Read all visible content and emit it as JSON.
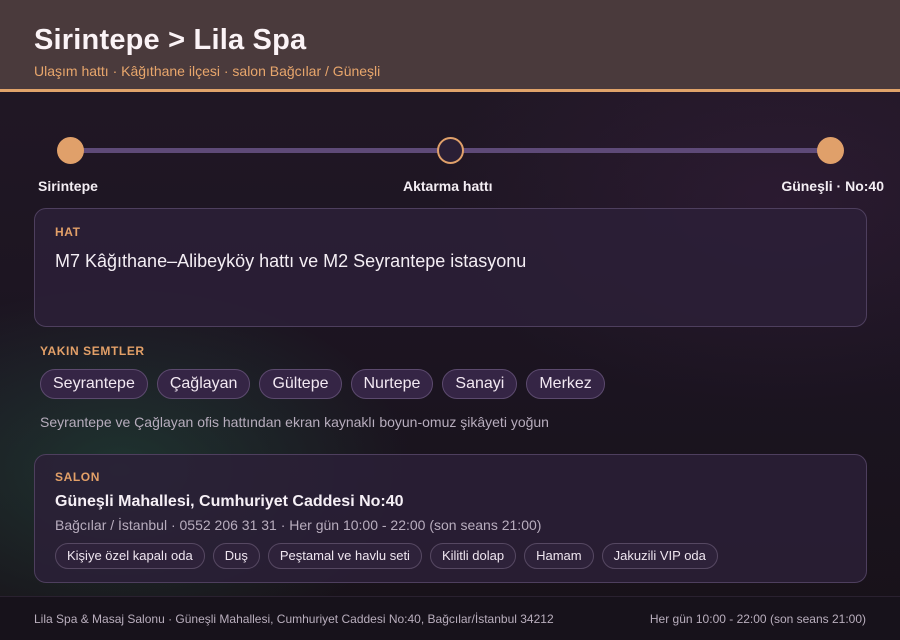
{
  "header": {
    "title": "Sirintepe > Lila Spa",
    "subtitle": "Ulaşım hattı · Kâğıthane ilçesi · salon Bağcılar / Güneşli"
  },
  "route": {
    "stops": [
      {
        "label": "Sirintepe"
      },
      {
        "label": "Aktarma hattı"
      },
      {
        "label": "Güneşli · No:40"
      }
    ]
  },
  "hat": {
    "label": "HAT",
    "text": "M7 Kâğıthane–Alibeyköy hattı ve M2 Seyrantepe istasyonu"
  },
  "nearby": {
    "label": "YAKIN SEMTLER",
    "items": [
      "Seyrantepe",
      "Çağlayan",
      "Gültepe",
      "Nurtepe",
      "Sanayi",
      "Merkez"
    ],
    "note": "Seyrantepe ve Çağlayan ofis hattından ekran kaynaklı boyun-omuz şikâyeti yoğun"
  },
  "salon": {
    "label": "SALON",
    "address": "Güneşli Mahallesi, Cumhuriyet Caddesi No:40",
    "meta": "Bağcılar / İstanbul · 0552 206 31 31 · Her gün 10:00 - 22:00 (son seans 21:00)",
    "features": [
      "Kişiye özel kapalı oda",
      "Duş",
      "Peştamal ve havlu seti",
      "Kilitli dolap",
      "Hamam",
      "Jakuzili VIP oda"
    ]
  },
  "footer": {
    "left": "Lila Spa & Masaj Salonu · Güneşli Mahallesi, Cumhuriyet Caddesi No:40, Bağcılar/İstanbul 34212",
    "right": "Her gün 10:00 - 22:00 (son seans 21:00)"
  },
  "colors": {
    "accent": "#e0a06a",
    "header_bg": "#4a3a3c",
    "route_line": "#5e4a78"
  }
}
